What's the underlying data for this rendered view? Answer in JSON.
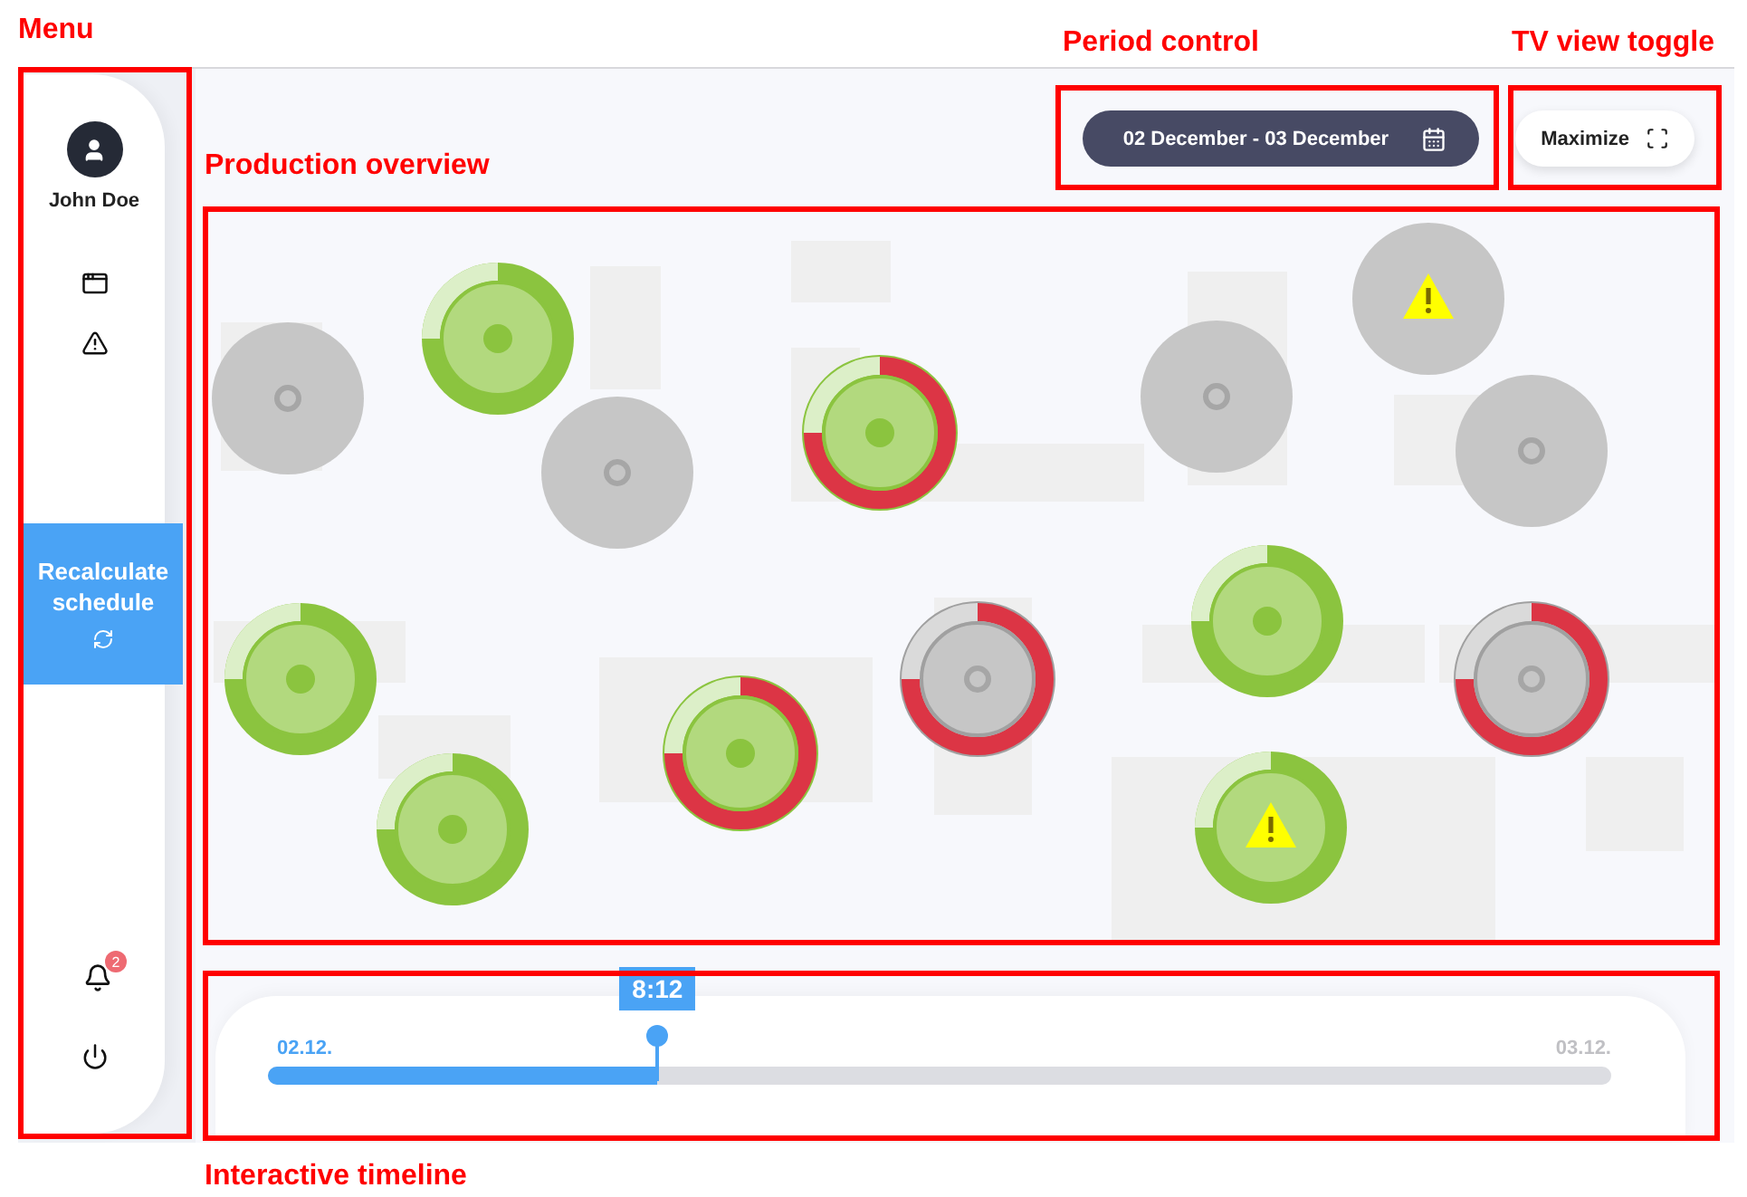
{
  "user": {
    "name": "John Doe"
  },
  "recalculate_button": {
    "label": "Recalculate schedule"
  },
  "notifications": {
    "count": "2"
  },
  "period": {
    "label": "02 December - 03 December"
  },
  "maximize_button": {
    "label": "Maximize"
  },
  "machines": [
    {
      "kind": "idle",
      "ring": false,
      "warning": false
    },
    {
      "kind": "running",
      "ring": true,
      "late": false,
      "warning": false
    },
    {
      "kind": "idle",
      "ring": false,
      "warning": false
    },
    {
      "kind": "running",
      "ring": true,
      "late": true,
      "warning": false
    },
    {
      "kind": "idle",
      "ring": false,
      "warning": false
    },
    {
      "kind": "idle",
      "ring": false,
      "warning": true
    },
    {
      "kind": "idle",
      "ring": false,
      "warning": false
    },
    {
      "kind": "running",
      "ring": true,
      "late": false,
      "warning": false
    },
    {
      "kind": "idle",
      "ring": true,
      "late": true,
      "warning": false
    },
    {
      "kind": "running",
      "ring": true,
      "late": true,
      "warning": false
    },
    {
      "kind": "running",
      "ring": true,
      "late": false,
      "warning": false
    },
    {
      "kind": "idle",
      "ring": true,
      "late": true,
      "warning": false
    },
    {
      "kind": "running",
      "ring": true,
      "late": false,
      "warning": true
    },
    {
      "kind": "running",
      "ring": true,
      "late": false,
      "warning": false
    }
  ],
  "timeline": {
    "start": "02.12.",
    "end": "03.12.",
    "time": "8:12",
    "level": 0.29
  },
  "annotations": [
    {
      "label": "Menu"
    },
    {
      "label": "Period control"
    },
    {
      "label": "TV view toggle"
    },
    {
      "label": "Production overview"
    },
    {
      "label": "Interactive timeline"
    }
  ]
}
